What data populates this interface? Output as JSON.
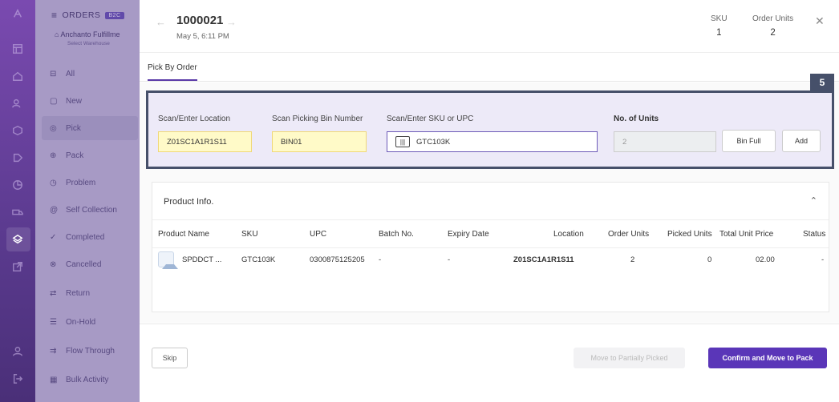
{
  "menu": {
    "title": "ORDERS",
    "badge": "B2C",
    "warehouse": "Anchanto Fulfillme",
    "warehouse_sub": "Select Warehouse",
    "items": [
      {
        "label": "All",
        "icon": "inbox-icon"
      },
      {
        "label": "New",
        "icon": "document-icon"
      },
      {
        "label": "Pick",
        "icon": "target-icon"
      },
      {
        "label": "Pack",
        "icon": "box-icon"
      },
      {
        "label": "Problem",
        "icon": "clock-icon"
      },
      {
        "label": "Self Collection",
        "icon": "at-icon"
      },
      {
        "label": "Completed",
        "icon": "check-circle-icon"
      },
      {
        "label": "Cancelled",
        "icon": "x-circle-icon"
      },
      {
        "label": "Return",
        "icon": "return-icon"
      },
      {
        "label": "On-Hold",
        "icon": "pause-icon"
      },
      {
        "label": "Flow Through",
        "icon": "flow-icon"
      },
      {
        "label": "Bulk Activity",
        "icon": "grid-icon"
      }
    ],
    "active_item": "Pick"
  },
  "order": {
    "number": "1000021",
    "date": "May 5, 6:11 PM",
    "sku_label": "SKU",
    "sku_value": "1",
    "units_label": "Order Units",
    "units_value": "2"
  },
  "tabs": [
    "Pick By Order"
  ],
  "step_badge": "5",
  "scan": {
    "location_label": "Scan/Enter Location",
    "location_value": "Z01SC1A1R1S11",
    "bin_label": "Scan Picking Bin Number",
    "bin_value": "BIN01",
    "sku_label": "Scan/Enter SKU or UPC",
    "sku_value": "GTC103K",
    "units_label": "No. of Units",
    "units_value": "2",
    "bin_full_button": "Bin Full",
    "add_button": "Add"
  },
  "product": {
    "title": "Product Info.",
    "columns": [
      "Product Name",
      "SKU",
      "UPC",
      "Batch No.",
      "Expiry Date",
      "Location",
      "Order Units",
      "Picked Units",
      "Total Unit Price",
      "Status"
    ],
    "rows": [
      {
        "name": "SPDDCT ...",
        "sku": "GTC103K",
        "upc": "0300875125205",
        "batch": "-",
        "expiry": "-",
        "location": "Z01SC1A1R1S11",
        "order_units": "2",
        "picked_units": "0",
        "price": "02.00",
        "status": "-"
      }
    ]
  },
  "footer": {
    "skip": "Skip",
    "move_partial": "Move to Partially Picked",
    "confirm": "Confirm and Move to Pack"
  },
  "colors": {
    "accent": "#5a36b8",
    "highlight_border": "#46506a",
    "scan_bg": "#edeaf8",
    "yellow_field": "#fffac8"
  }
}
